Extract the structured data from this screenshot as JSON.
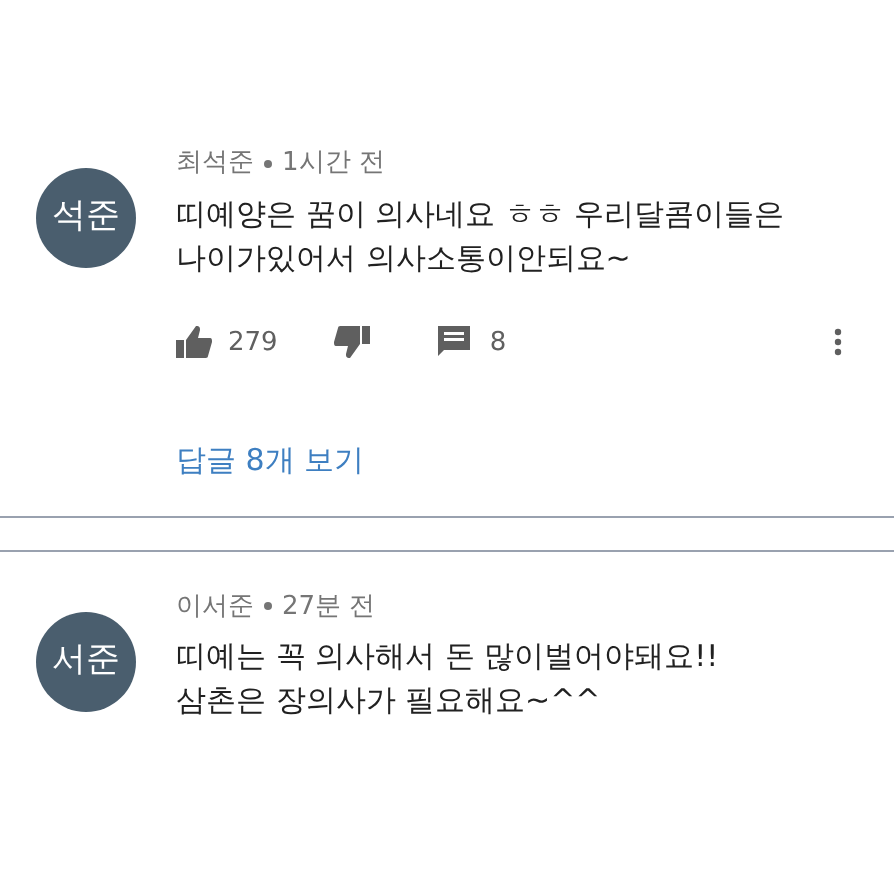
{
  "comments": [
    {
      "avatar": "석준",
      "author": "최석준",
      "time": "1시간 전",
      "text": "띠예양은 꿈이 의사네요 ㅎㅎ 우리달콤이들은\n나이가있어서 의사소통이안되요~",
      "likes": "279",
      "reply_count": "8",
      "view_replies": "답글 8개 보기"
    },
    {
      "avatar": "서준",
      "author": "이서준",
      "time": "27분 전",
      "text": "띠예는 꼭 의사해서 돈 많이벌어야돼요!!\n삼촌은 장의사가 필요해요~^^"
    }
  ]
}
